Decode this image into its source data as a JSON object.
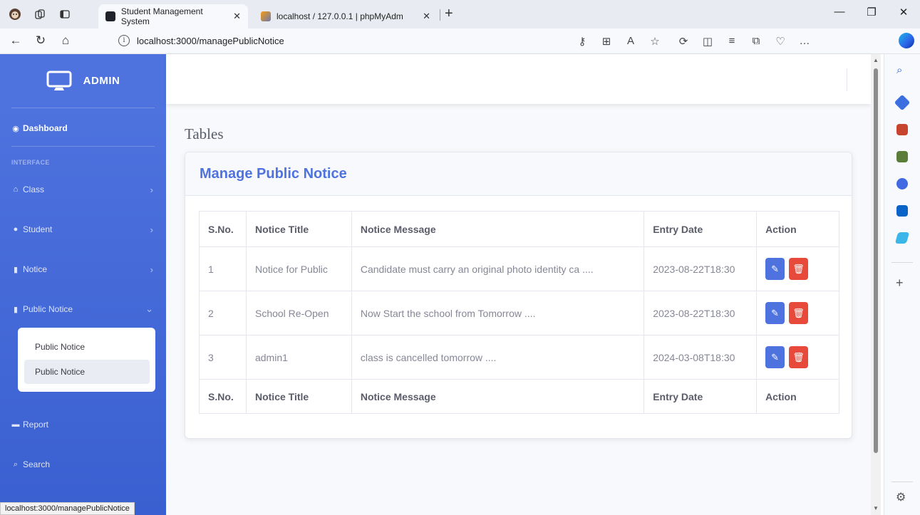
{
  "browser": {
    "tabs": [
      {
        "label": "Student Management System",
        "active": true
      },
      {
        "label": "localhost / 127.0.0.1 | phpMyAdm",
        "active": false
      }
    ],
    "url_host": "localhost",
    "url_path": ":3000/managePublicNotice",
    "status_url": "localhost:3000/managePublicNotice"
  },
  "sidebar": {
    "brand": "ADMIN",
    "dashboard": "Dashboard",
    "heading": "INTERFACE",
    "items": [
      {
        "label": "Class"
      },
      {
        "label": "Student"
      },
      {
        "label": "Notice"
      },
      {
        "label": "Public Notice"
      },
      {
        "label": "Report"
      },
      {
        "label": "Search"
      }
    ],
    "submenu": [
      "Public Notice",
      "Public Notice"
    ]
  },
  "main": {
    "page_heading": "Tables",
    "card_title": "Manage Public Notice",
    "columns": [
      "S.No.",
      "Notice Title",
      "Notice Message",
      "Entry Date",
      "Action"
    ],
    "rows": [
      {
        "sno": "1",
        "title": "Notice for Public",
        "message": "Candidate must carry an original photo identity ca ....",
        "date": "2023-08-22T18:30"
      },
      {
        "sno": "2",
        "title": "School Re-Open",
        "message": "Now Start the school from Tomorrow ....",
        "date": "2023-08-22T18:30"
      },
      {
        "sno": "3",
        "title": "admin1",
        "message": "class is cancelled tomorrow ....",
        "date": "2024-03-08T18:30"
      }
    ]
  },
  "colors": {
    "primary": "#4e73df",
    "danger": "#e74a3b"
  }
}
